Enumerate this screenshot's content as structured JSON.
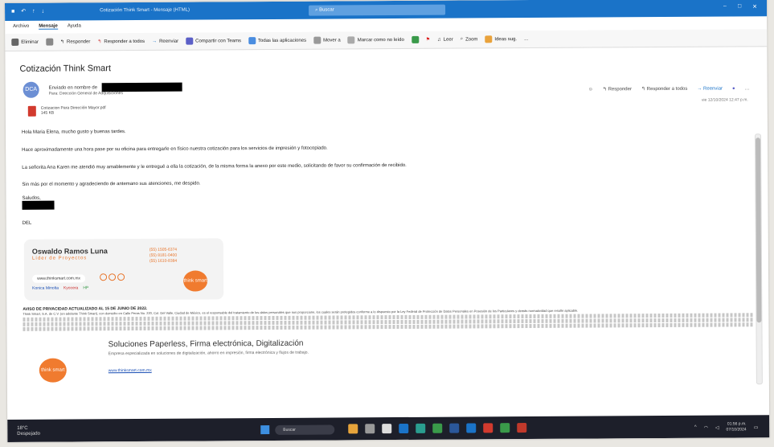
{
  "window": {
    "title": "Cotización Think Smart - Mensaje (HTML)",
    "search_placeholder": "Buscar",
    "menu": [
      "Archivo",
      "Mensaje",
      "Ayuda"
    ]
  },
  "ribbon": {
    "delete": "Eliminar",
    "reply": "Responder",
    "reply_all": "Responder a todos",
    "forward": "Reenviar",
    "share_teams": "Compartir con Teams",
    "all_apps": "Todas las aplicaciones",
    "move": "Mover a",
    "mark_unread": "Marcar como no leído",
    "read_aloud": "Leer",
    "zoom": "Zoom",
    "ideas": "Ideas sug.",
    "more": "..."
  },
  "email": {
    "subject": "Cotización Think Smart",
    "avatar_initials": "DCA",
    "from_prefix": "Enviado en nombre de",
    "to": "Para: Dirección General de Adquisiciones",
    "attachment_name": "Cotizacion Para Dirección Mayor.pdf",
    "attachment_size": "145 KB",
    "actions": {
      "reply": "Responder",
      "reply_all": "Responder a todos",
      "forward": "Reenviar"
    },
    "date": "vie 12/10/2024 12:47 p.m.",
    "body": [
      "Hola Maria Elena, mucho gusto y buenas tardes.",
      "Hace aproximadamente una hora pase por su oficina para entregarle en físico nuestra cotización para los servicios de impresión y fotocopiado.",
      "La señorita Ana Karen me atendió muy amablemente y le entregué a ella la cotización, de la misma forma la anexo por este medio, solicitando de favor su confirmación de recibido.",
      "Sin más por el momento y agradeciendo de antemano sus atenciones, me despido."
    ],
    "closing": "Saludos,",
    "label_del": "DEL"
  },
  "signature": {
    "name": "Oswaldo Ramos Luna",
    "role": "Líder de Proyectos",
    "phones": [
      "(55) 1505-6374",
      "(55) 8181-0400",
      "(55) 1610-8384"
    ],
    "website": "www.thinksmart.com.mx",
    "brands": [
      "Konica Minolta",
      "Kyocera",
      "HP"
    ],
    "logo_text": "think smart"
  },
  "legal": {
    "title": "AVISO DE PRIVACIDAD ACTUALIZADO AL 15 DE JUNIO DE 2022.",
    "text": "Think Smart, S.A. de C.V. (en adelante Think Smart), con domicilio en Calle Peras No. 220, Col. Del Valle, Ciudad de México, es el responsable del tratamiento de los datos personales que nos proporcione, los cuales serán protegidos conforme a lo dispuesto por la Ley Federal de Protección de Datos Personales en Posesión de los Particulares y demás normatividad que resulte aplicable."
  },
  "promo": {
    "title": "Soluciones Paperless, Firma electrónica, Digitalización",
    "text": "Empresa especializada en soluciones de digitalización, ahorro en impresión, firma electrónica y flujos de trabajo.",
    "link": "www.thinksmart.com.mx",
    "logo_text": "think smart"
  },
  "taskbar": {
    "temp": "18°C",
    "weather": "Despejado",
    "search": "Buscar",
    "time": "01:56 p.m.",
    "date": "07/10/2024"
  }
}
